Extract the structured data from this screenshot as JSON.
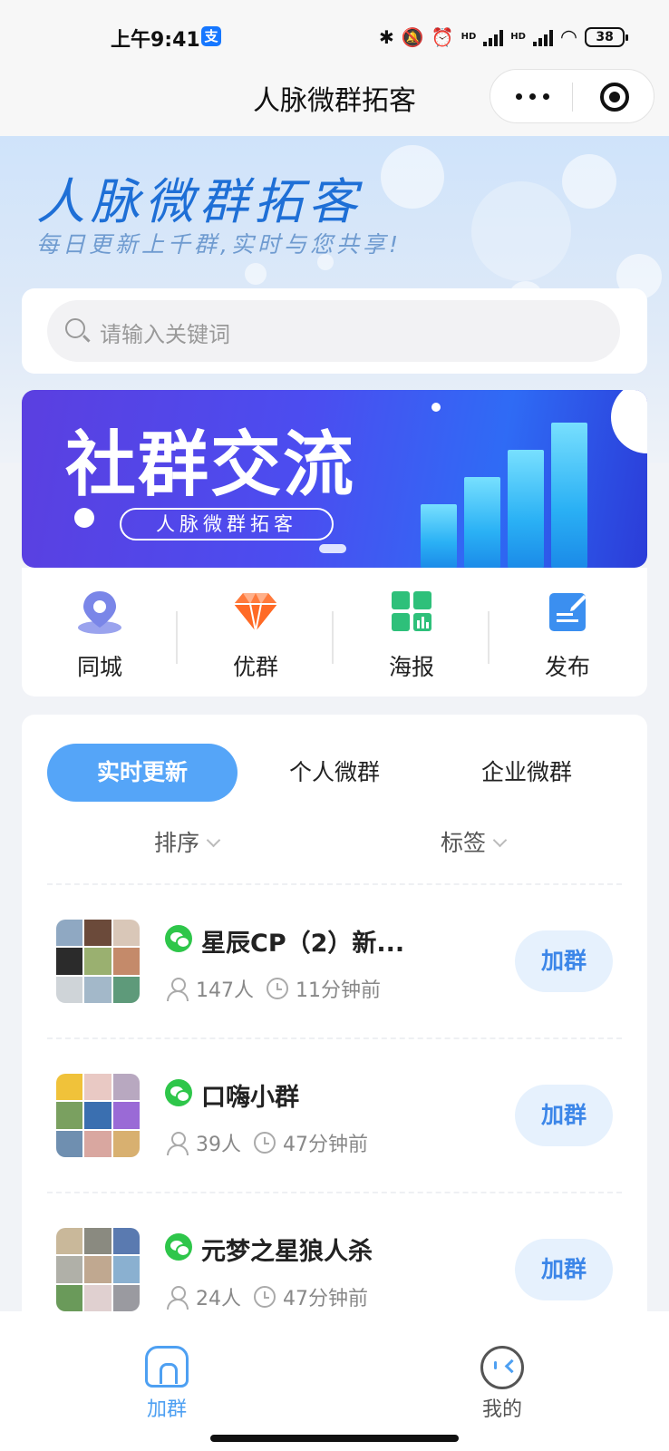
{
  "status_bar": {
    "time": "上午9:41",
    "pay_badge": "支",
    "battery": "38",
    "signal_label": "HD"
  },
  "nav": {
    "title": "人脉微群拓客"
  },
  "hero": {
    "title": "人脉微群拓客",
    "subtitle": "每日更新上千群,实时与您共享!"
  },
  "search": {
    "placeholder": "请输入关键词"
  },
  "banner": {
    "title": "社群交流",
    "pill_text": "人脉微群拓客"
  },
  "quick_menu": {
    "items": [
      {
        "label": "同城",
        "icon": "location-pin-icon",
        "color": "#7a86e8"
      },
      {
        "label": "优群",
        "icon": "diamond-icon",
        "color": "#ff7a3c"
      },
      {
        "label": "海报",
        "icon": "poster-grid-icon",
        "color": "#2ec07a"
      },
      {
        "label": "发布",
        "icon": "edit-note-icon",
        "color": "#3b8ff0"
      }
    ]
  },
  "tabs": [
    {
      "label": "实时更新",
      "active": true
    },
    {
      "label": "个人微群",
      "active": false
    },
    {
      "label": "企业微群",
      "active": false
    }
  ],
  "filters": {
    "sort_label": "排序",
    "tag_label": "标签"
  },
  "groups": [
    {
      "name": "星辰CP（2）新...",
      "members": "147人",
      "time": "11分钟前",
      "action": "加群"
    },
    {
      "name": "口嗨小群",
      "members": "39人",
      "time": "47分钟前",
      "action": "加群"
    },
    {
      "name": "元梦之星狼人杀",
      "members": "24人",
      "time": "47分钟前",
      "action": "加群"
    }
  ],
  "tabbar": {
    "items": [
      {
        "label": "加群",
        "active": true
      },
      {
        "label": "我的",
        "active": false
      }
    ]
  },
  "colors": {
    "accent": "#55a5f8",
    "join_bg": "#e6f1fd",
    "join_text": "#3c86e8",
    "wechat_green": "#2ec64a"
  }
}
